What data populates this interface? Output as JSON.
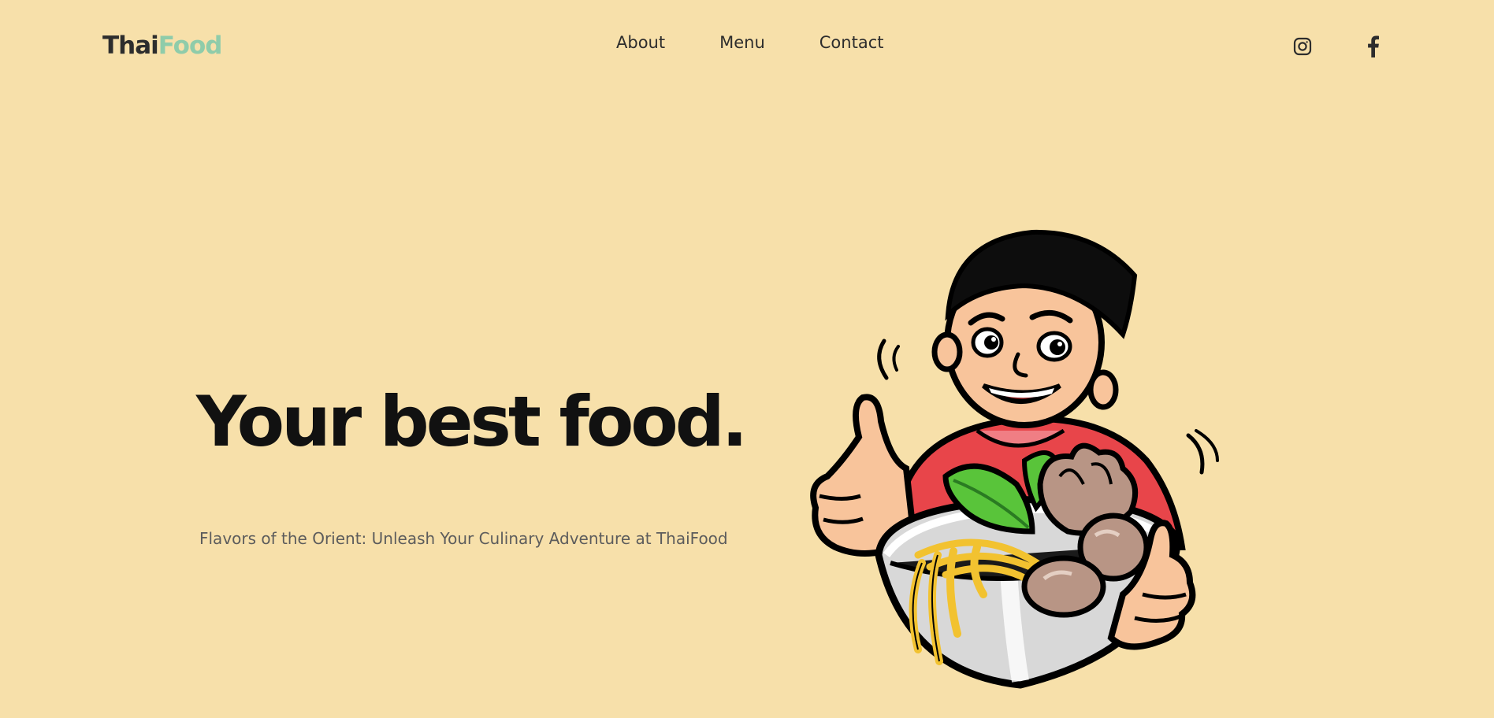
{
  "brand": {
    "name_part1": "Thai",
    "name_part2": "Food",
    "accent_color": "#8fccaa",
    "background_color": "#f7e0aa"
  },
  "nav": {
    "items": [
      {
        "label": "About"
      },
      {
        "label": "Menu"
      },
      {
        "label": "Contact"
      }
    ]
  },
  "social": {
    "icons": [
      "instagram-icon",
      "facebook-icon"
    ]
  },
  "hero": {
    "title": "Your best food.",
    "subtitle": "Flavors of the Orient: Unleash Your Culinary Adventure at ThaiFood"
  }
}
